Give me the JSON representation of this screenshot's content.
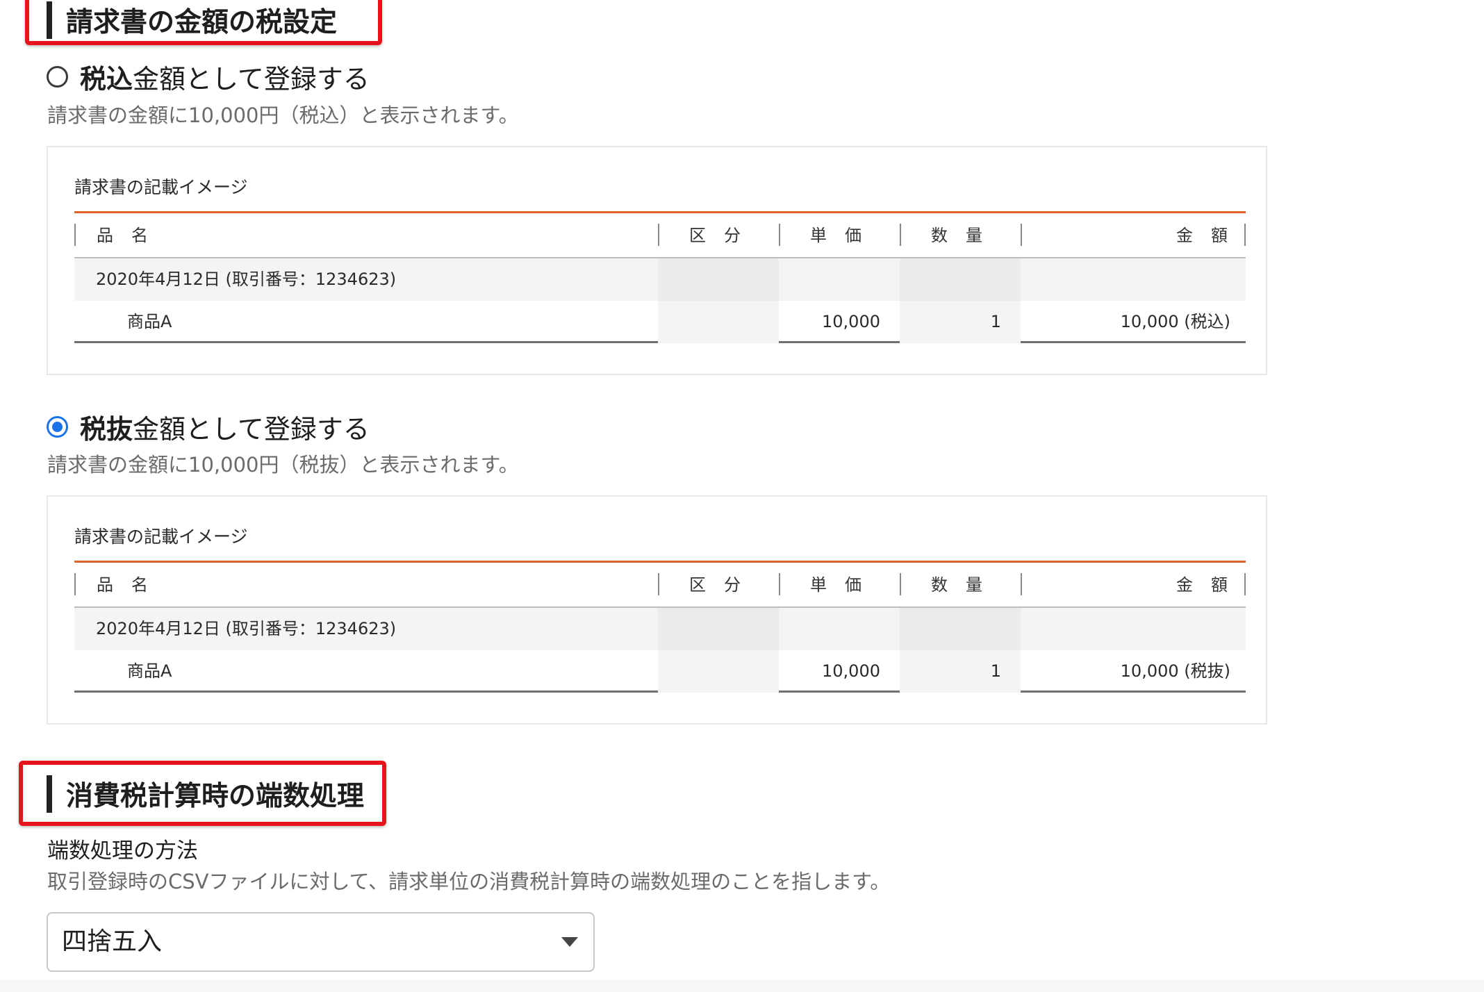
{
  "tax_setting": {
    "heading": "請求書の金額の税設定",
    "options": [
      {
        "label_strong": "税込",
        "label_rest": "金額として登録する",
        "checked": false,
        "description": "請求書の金額に10,000円（税込）と表示されます。",
        "preview": {
          "title": "請求書の記載イメージ",
          "columns": [
            "品名",
            "区分",
            "単価",
            "数量",
            "金額"
          ],
          "date_row": "2020年4月12日 (取引番号：1234623)",
          "item": {
            "name": "商品A",
            "category": "",
            "unit_price": "10,000",
            "quantity": "1",
            "amount": "10,000 (税込)"
          }
        }
      },
      {
        "label_strong": "税抜",
        "label_rest": "金額として登録する",
        "checked": true,
        "description": "請求書の金額に10,000円（税抜）と表示されます。",
        "preview": {
          "title": "請求書の記載イメージ",
          "columns": [
            "品名",
            "区分",
            "単価",
            "数量",
            "金額"
          ],
          "date_row": "2020年4月12日 (取引番号：1234623)",
          "item": {
            "name": "商品A",
            "category": "",
            "unit_price": "10,000",
            "quantity": "1",
            "amount": "10,000 (税抜)"
          }
        }
      }
    ]
  },
  "rounding": {
    "heading": "消費税計算時の端数処理",
    "field_label": "端数処理の方法",
    "description": "取引登録時のCSVファイルに対して、請求単位の消費税計算時の端数処理のことを指します。",
    "select_value": "四捨五入"
  },
  "colors": {
    "highlight": "#e8141b",
    "accent_rule": "#e0632a",
    "radio_checked": "#1a73e8"
  },
  "icons": {
    "dropdown": "caret-down-icon"
  }
}
